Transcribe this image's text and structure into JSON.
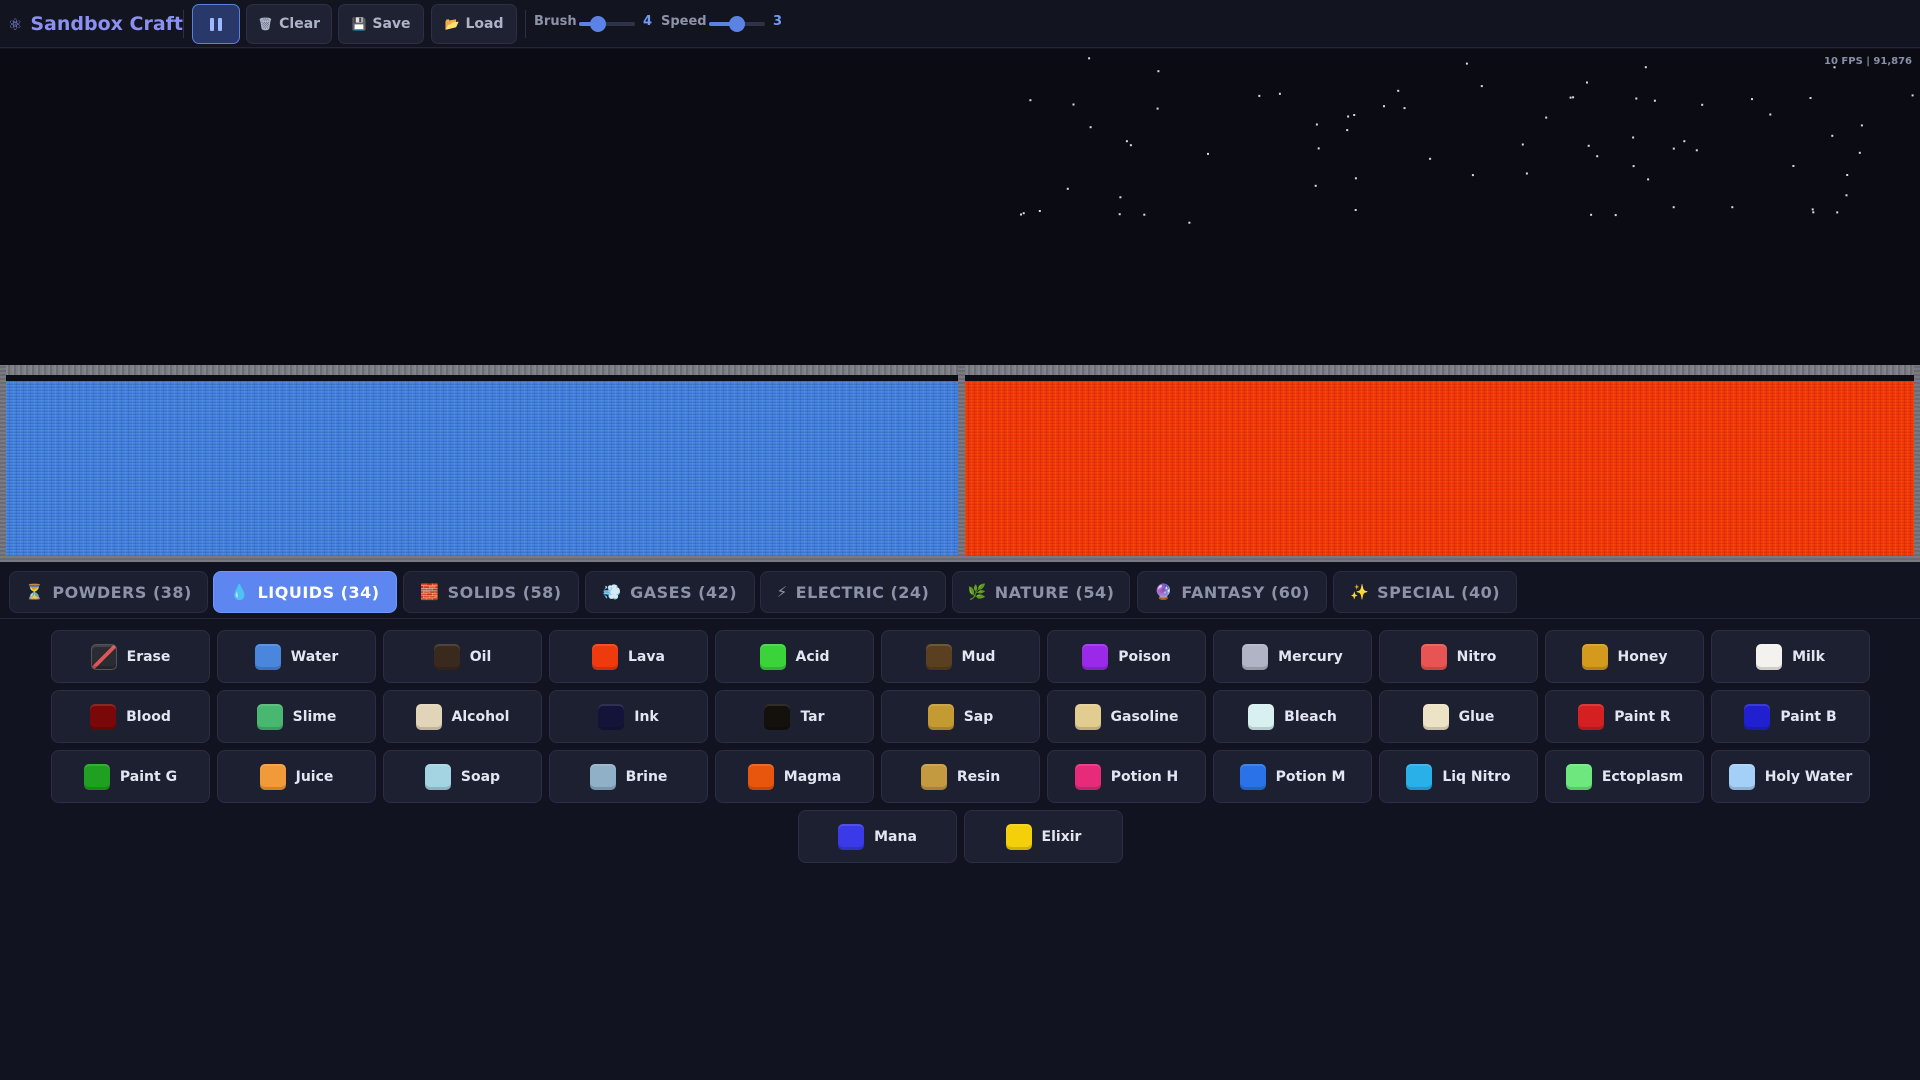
{
  "app": {
    "title": "Sandbox Craft",
    "logo_icon": "⚛"
  },
  "toolbar": {
    "pause_icon": "pause-icon",
    "clear": {
      "icon": "🗑",
      "label": "Clear"
    },
    "save": {
      "icon": "💾",
      "label": "Save"
    },
    "load": {
      "icon": "📂",
      "label": "Load"
    },
    "brush": {
      "label": "Brush",
      "value": 4,
      "min": 1,
      "max": 10
    },
    "speed": {
      "label": "Speed",
      "value": 3,
      "min": 1,
      "max": 5
    }
  },
  "canvas": {
    "status": "10 FPS | 91,876",
    "left_pool_material": "Water",
    "right_pool_material": "Lava"
  },
  "tabs": [
    {
      "icon": "⏳",
      "label": "POWDERS (38)",
      "active": false
    },
    {
      "icon": "💧",
      "label": "LIQUIDS (34)",
      "active": true
    },
    {
      "icon": "🧱",
      "label": "SOLIDS (58)",
      "active": false
    },
    {
      "icon": "💨",
      "label": "GASES (42)",
      "active": false
    },
    {
      "icon": "⚡",
      "label": "ELECTRIC (24)",
      "active": false
    },
    {
      "icon": "🌿",
      "label": "NATURE (54)",
      "active": false
    },
    {
      "icon": "🔮",
      "label": "FANTASY (60)",
      "active": false
    },
    {
      "icon": "✨",
      "label": "SPECIAL (40)",
      "active": false
    }
  ],
  "elements": [
    {
      "label": "Erase",
      "color": "erase"
    },
    {
      "label": "Water",
      "color": "#4a86dc"
    },
    {
      "label": "Oil",
      "color": "#3a2a1e"
    },
    {
      "label": "Lava",
      "color": "#ee3a0c"
    },
    {
      "label": "Acid",
      "color": "#3ad43a"
    },
    {
      "label": "Mud",
      "color": "#5a4020"
    },
    {
      "label": "Poison",
      "color": "#9a2ae8"
    },
    {
      "label": "Mercury",
      "color": "#b0b4c4"
    },
    {
      "label": "Nitro",
      "color": "#e85454"
    },
    {
      "label": "Honey",
      "color": "#d49a1e"
    },
    {
      "label": "Milk",
      "color": "#f4f2ee"
    },
    {
      "label": "Blood",
      "color": "#7a0808"
    },
    {
      "label": "Slime",
      "color": "#48b870"
    },
    {
      "label": "Alcohol",
      "color": "#e2d4b8"
    },
    {
      "label": "Ink",
      "color": "#14143a"
    },
    {
      "label": "Tar",
      "color": "#14100c"
    },
    {
      "label": "Sap",
      "color": "#c49a32"
    },
    {
      "label": "Gasoline",
      "color": "#e2cc90"
    },
    {
      "label": "Bleach",
      "color": "#d8f0f0"
    },
    {
      "label": "Glue",
      "color": "#ece2c6"
    },
    {
      "label": "Paint R",
      "color": "#d42020"
    },
    {
      "label": "Paint B",
      "color": "#2020d0"
    },
    {
      "label": "Paint G",
      "color": "#20a020"
    },
    {
      "label": "Juice",
      "color": "#f09a3a"
    },
    {
      "label": "Soap",
      "color": "#a4d4e2"
    },
    {
      "label": "Brine",
      "color": "#90b0c8"
    },
    {
      "label": "Magma",
      "color": "#e8560e"
    },
    {
      "label": "Resin",
      "color": "#c49a40"
    },
    {
      "label": "Potion H",
      "color": "#e82a7a"
    },
    {
      "label": "Potion M",
      "color": "#2a72e8"
    },
    {
      "label": "Liq Nitro",
      "color": "#2ab0e8"
    },
    {
      "label": "Ectoplasm",
      "color": "#6ee87e"
    },
    {
      "label": "Holy Water",
      "color": "#a4d0f8"
    },
    {
      "label": "Mana",
      "color": "#3a3ae8"
    },
    {
      "label": "Elixir",
      "color": "#f4d00a"
    }
  ]
}
